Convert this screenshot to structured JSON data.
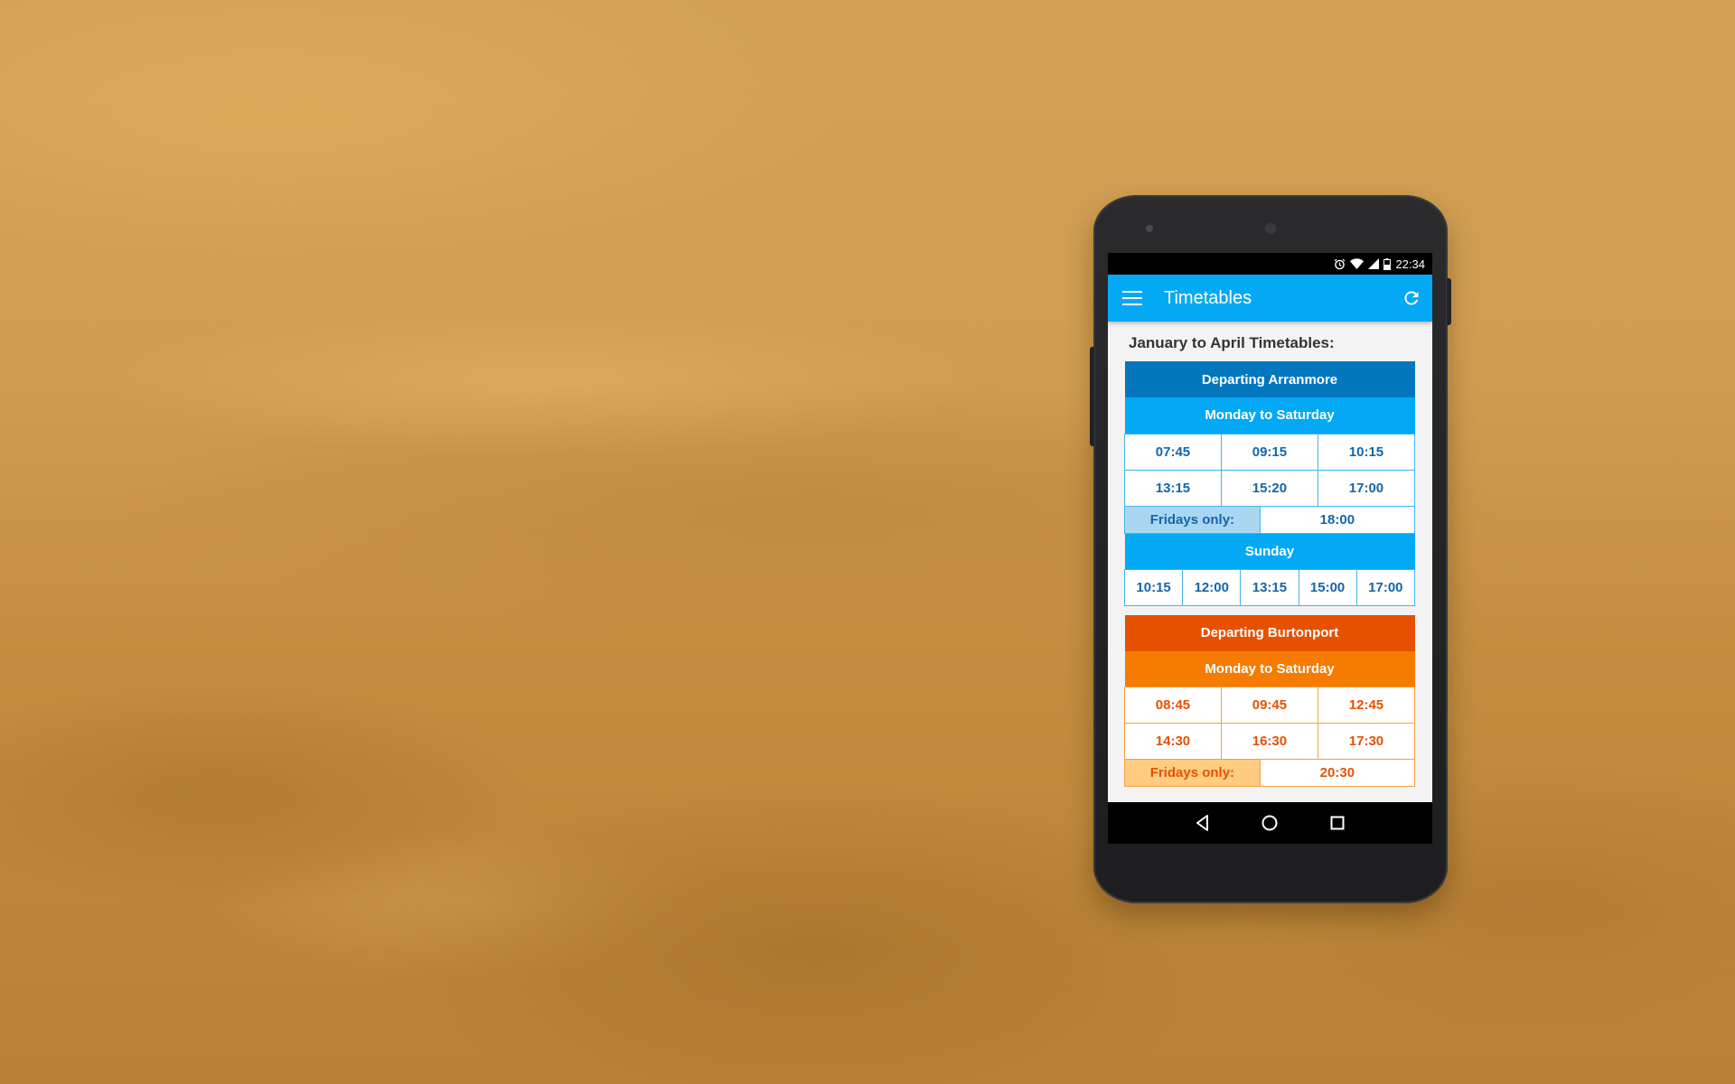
{
  "status_bar": {
    "time": "22:34",
    "icons": [
      "alarm-icon",
      "wifi-icon",
      "signal-icon",
      "battery-icon"
    ]
  },
  "app_bar": {
    "title": "Timetables",
    "menu_icon": "hamburger-menu-icon",
    "refresh_icon": "refresh-icon",
    "color": "#03a9f4"
  },
  "content": {
    "heading": "January to April Timetables:",
    "arranmore": {
      "title": "Departing Arranmore",
      "weekday_label": "Monday to Saturday",
      "weekday_rows": [
        [
          "07:45",
          "09:15",
          "10:15"
        ],
        [
          "13:15",
          "15:20",
          "17:00"
        ]
      ],
      "fridays_label": "Fridays only:",
      "fridays_time": "18:00",
      "sunday_label": "Sunday",
      "sunday_times": [
        "10:15",
        "12:00",
        "13:15",
        "15:00",
        "17:00"
      ],
      "colors": {
        "header": "#0277bd",
        "subheader": "#03a9f4"
      }
    },
    "burtonport": {
      "title": "Departing Burtonport",
      "weekday_label": "Monday to Saturday",
      "weekday_rows": [
        [
          "08:45",
          "09:45",
          "12:45"
        ],
        [
          "14:30",
          "16:30",
          "17:30"
        ]
      ],
      "fridays_label": "Fridays only:",
      "fridays_time": "20:30",
      "colors": {
        "header": "#e65100",
        "subheader": "#f57c00"
      }
    }
  },
  "nav_bar": {
    "icons": [
      "back-triangle-icon",
      "home-circle-icon",
      "recents-square-icon"
    ]
  }
}
